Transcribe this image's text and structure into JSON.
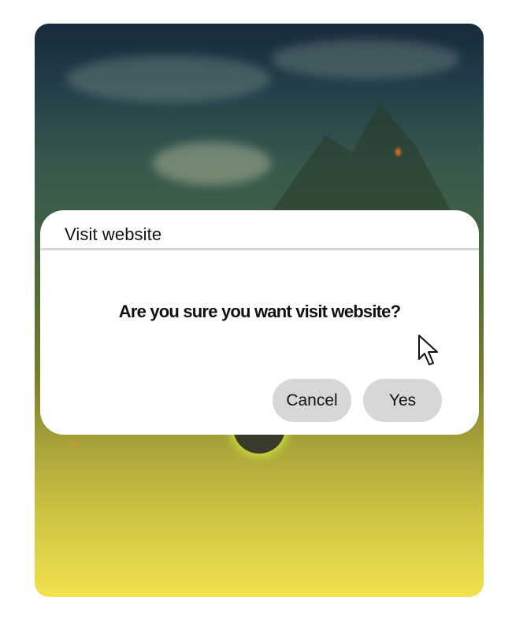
{
  "dialog": {
    "title": "Visit website",
    "message": "Are you sure you want visit website?",
    "cancel_label": "Cancel",
    "yes_label": "Yes"
  },
  "background": {
    "description_icon": "landscape-wallpaper",
    "colors": {
      "sky_top": "#172a3a",
      "mid_green": "#3f5f46",
      "bottom_yellow": "#f2e24f"
    }
  },
  "cursor": {
    "icon": "mouse-pointer-icon"
  }
}
